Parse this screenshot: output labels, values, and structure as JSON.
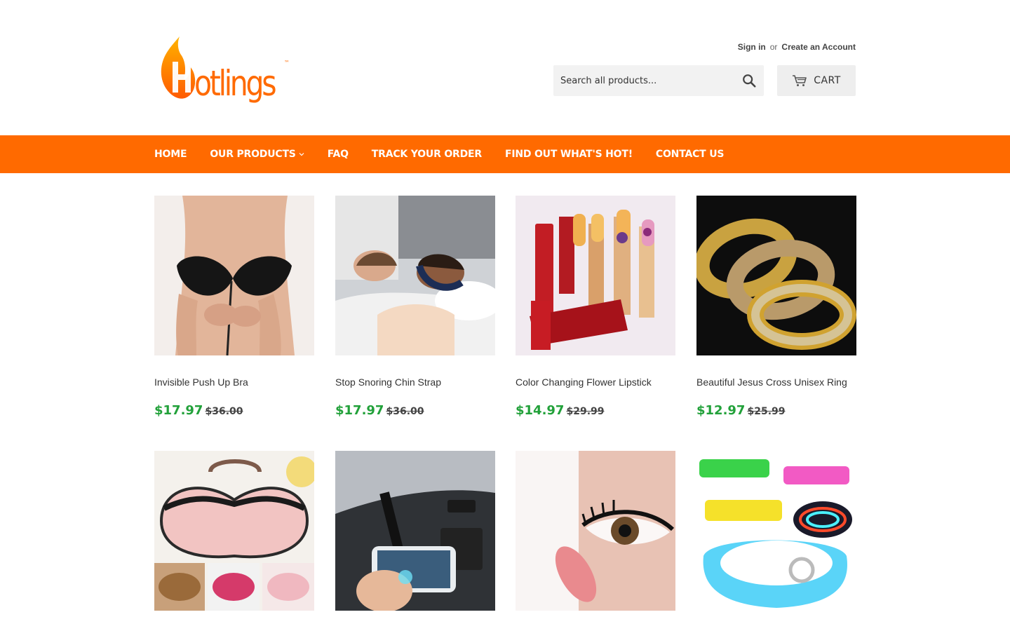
{
  "brand": {
    "logo_text": "Hotlings",
    "tm": "™"
  },
  "account": {
    "sign_in": "Sign in",
    "or": "or",
    "create_account": "Create an Account"
  },
  "search": {
    "placeholder": "Search all products..."
  },
  "cart": {
    "label": "CART"
  },
  "colors": {
    "accent": "#ff6a00",
    "sale_price": "#22a13a"
  },
  "nav": {
    "items": [
      {
        "label": "HOME"
      },
      {
        "label": "OUR PRODUCTS",
        "has_dropdown": true
      },
      {
        "label": "FAQ"
      },
      {
        "label": "TRACK YOUR ORDER"
      },
      {
        "label": "FIND OUT WHAT'S HOT!"
      },
      {
        "label": "CONTACT US"
      }
    ]
  },
  "products": [
    {
      "title": "Invisible Push Up Bra",
      "price": "$17.97",
      "compare_price": "$36.00",
      "image": "bra-photo"
    },
    {
      "title": "Stop Snoring Chin Strap",
      "price": "$17.97",
      "compare_price": "$36.00",
      "image": "chin-strap-photo"
    },
    {
      "title": "Color Changing Flower Lipstick",
      "price": "$14.97",
      "compare_price": "$29.99",
      "image": "lipstick-photo"
    },
    {
      "title": "Beautiful Jesus Cross Unisex Ring",
      "price": "$12.97",
      "compare_price": "$25.99",
      "image": "ring-photo"
    },
    {
      "title": "",
      "price": "",
      "compare_price": "",
      "image": "bra-case-photo"
    },
    {
      "title": "",
      "price": "",
      "compare_price": "",
      "image": "car-phone-mount-photo"
    },
    {
      "title": "",
      "price": "",
      "compare_price": "",
      "image": "eyelash-photo"
    },
    {
      "title": "",
      "price": "",
      "compare_price": "",
      "image": "led-dog-collar-photo"
    }
  ]
}
